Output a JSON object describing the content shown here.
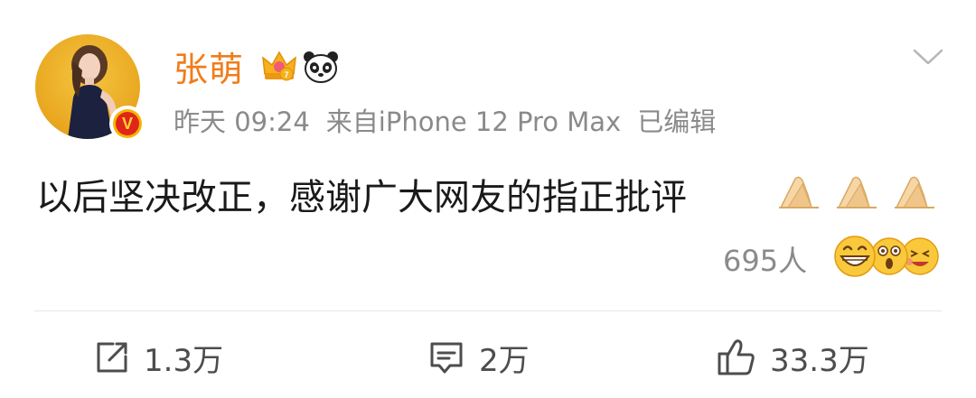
{
  "post": {
    "username": "张萌",
    "meta": {
      "time": "昨天 09:24",
      "source": "来自iPhone 12 Pro Max",
      "edited": "已编辑"
    },
    "text": "以后坚决改正，感谢广大网友的指正批评",
    "reactions_count": "695人",
    "actions": {
      "repost": "1.3万",
      "comment": "2万",
      "like": "33.3万"
    },
    "icons": {
      "verified": "verified-v-icon",
      "crown": "crown-badge-icon",
      "panda": "panda-badge-icon",
      "more": "chevron-down-icon",
      "hands": "folded-hands-emoji",
      "reactions": [
        "grinning-face-emoji",
        "shocked-face-emoji",
        "laughing-face-emoji"
      ],
      "repost": "repost-icon",
      "comment": "comment-icon",
      "like": "thumbs-up-icon"
    },
    "colors": {
      "username": "#f07d1a",
      "meta": "#8a8a8a",
      "text": "#1a1a1a",
      "verified": "#e0261b"
    }
  }
}
